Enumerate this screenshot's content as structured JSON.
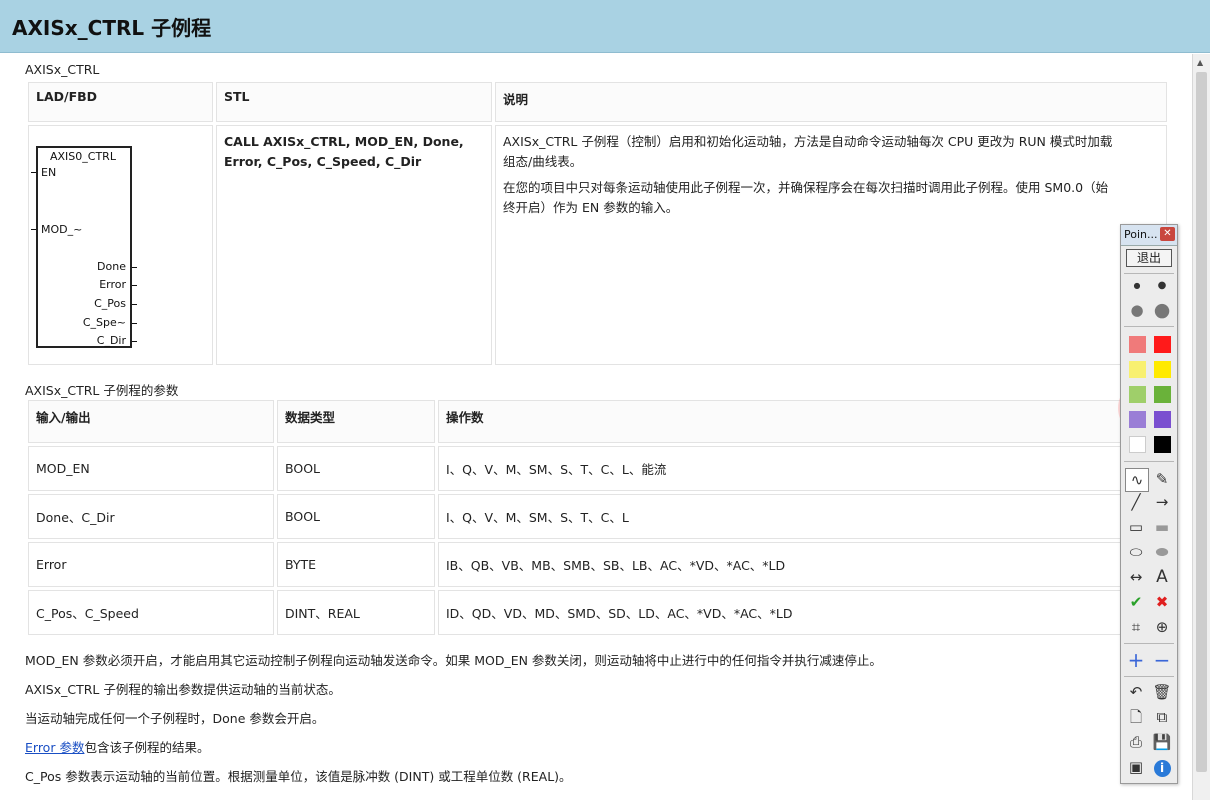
{
  "page": {
    "title": "AXISx_CTRL 子例程"
  },
  "section1_label": "AXISx_CTRL",
  "table1": {
    "headers": [
      "LAD/FBD",
      "STL",
      "说明"
    ],
    "stl": [
      "CALL AXISx_CTRL, MOD_EN, Done,",
      "Error, C_Pos, C_Speed, C_Dir"
    ],
    "desc": [
      "AXISx_CTRL 子例程（控制）启用和初始化运动轴，方法是自动命令运动轴每次 CPU 更改为 RUN 模式时加载",
      "组态/曲线表。",
      "在您的项目中只对每条运动轴使用此子例程一次，并确保程序会在每次扫描时调用此子例程。使用 SM0.0（始",
      "终开启）作为 EN 参数的输入。"
    ],
    "lad": {
      "block_name": "AXIS0_CTRL",
      "inputs": [
        "EN",
        "MOD_~"
      ],
      "outputs": [
        "Done",
        "Error",
        "C_Pos",
        "C_Spe~",
        "C_Dir"
      ]
    }
  },
  "section2_label": "AXISx_CTRL 子例程的参数",
  "table2": {
    "headers": [
      "输入/输出",
      "数据类型",
      "操作数"
    ],
    "rows": [
      [
        "MOD_EN",
        "BOOL",
        "I、Q、V、M、SM、S、T、C、L、能流"
      ],
      [
        "Done、C_Dir",
        "BOOL",
        "I、Q、V、M、SM、S、T、C、L"
      ],
      [
        "Error",
        "BYTE",
        "IB、QB、VB、MB、SMB、SB、LB、AC、*VD、*AC、*LD"
      ],
      [
        "C_Pos、C_Speed",
        "DINT、REAL",
        "ID、QD、VD、MD、SMD、SD、LD、AC、*VD、*AC、*LD"
      ]
    ]
  },
  "paragraphs": {
    "p1": "MOD_EN 参数必须开启，才能启用其它运动控制子例程向运动轴发送命令。如果 MOD_EN 参数关闭，则运动轴将中止进行中的任何指令并执行减速停止。",
    "p2": "AXISx_CTRL 子例程的输出参数提供运动轴的当前状态。",
    "p3": "当运动轴完成任何一个子例程时，Done 参数会开启。",
    "p4_link": "Error 参数",
    "p4_rest": "包含该子例程的结果。",
    "p5": "C_Pos 参数表示运动轴的当前位置。根据测量单位，该值是脉冲数 (DINT) 或工程单位数 (REAL)。"
  },
  "palette": {
    "title": "Poin...",
    "exit_label": "退出",
    "text_tool": "A",
    "colors": [
      "#f07a7a",
      "#ff1a1a",
      "#f8f070",
      "#ffea00",
      "#9fcf6a",
      "#6ab23a",
      "#9a7ed6",
      "#7a4fd0",
      "#ffffff",
      "#000000"
    ]
  }
}
